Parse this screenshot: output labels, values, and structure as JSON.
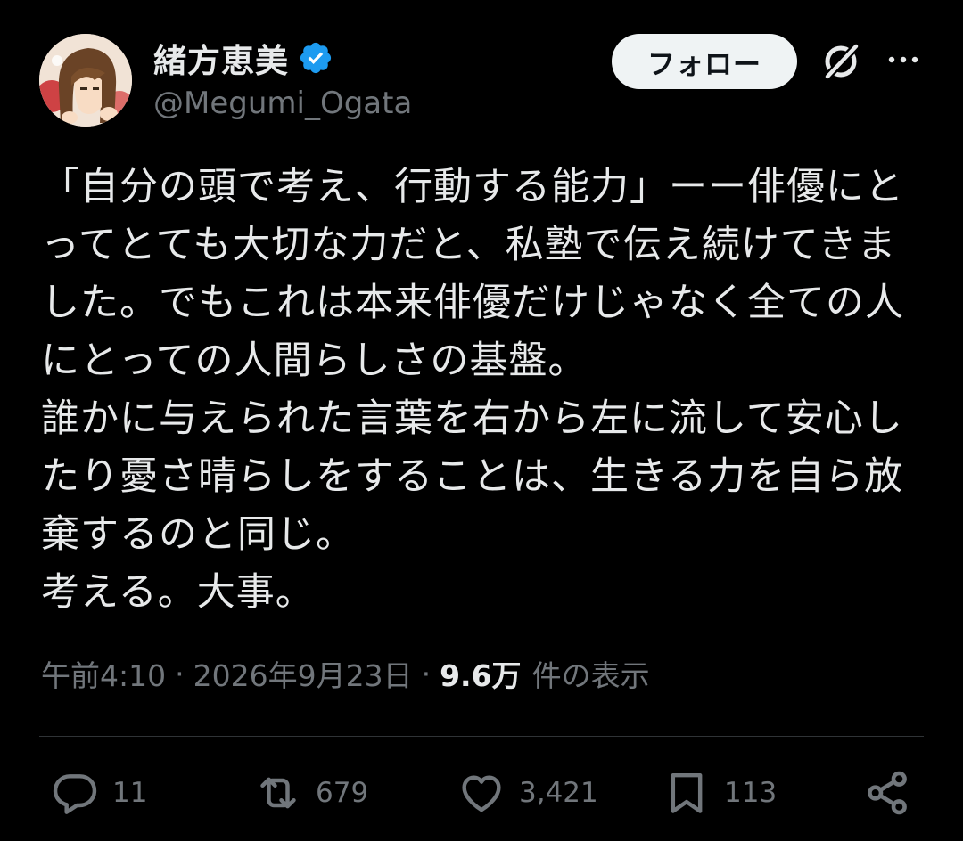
{
  "author": {
    "display_name": "緒方恵美",
    "handle": "@Megumi_Ogata",
    "verified": true,
    "avatar_icon": "avatar-illustration"
  },
  "header": {
    "follow_label": "フォロー",
    "grok_icon": "grok-icon",
    "more_icon": "more-horizontal-icon"
  },
  "tweet": {
    "lines": [
      "「自分の頭で考え、行動する能力」ーー俳優にと",
      "ってとても大切な力だと、私塾で伝え続けてきま",
      "した。でもこれは本来俳優だけじゃなく全ての人",
      "にとっての人間らしさの基盤。",
      "誰かに与えられた言葉を右から左に流して安心し",
      "たり憂さ晴らしをすることは、生きる力を自ら放",
      "棄するのと同じ。",
      "考える。大事。"
    ]
  },
  "meta": {
    "time": "午前4:10",
    "separator": "·",
    "date": "2026年9月23日",
    "views_count": "9.6万",
    "views_label": "件の表示"
  },
  "actions": {
    "replies": "11",
    "reposts": "679",
    "likes": "3,421",
    "bookmarks": "113"
  },
  "colors": {
    "background": "#000000",
    "text_primary": "#e7e9ea",
    "text_secondary": "#71767b",
    "verified_badge": "#1d9bf0",
    "follow_button_bg": "#eff3f4",
    "divider": "#2f3336"
  }
}
